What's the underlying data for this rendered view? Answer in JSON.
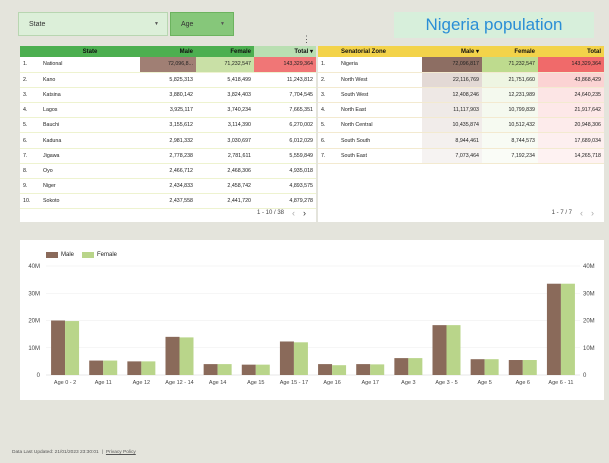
{
  "filters": {
    "state": "State",
    "age": "Age"
  },
  "title": "Nigeria population",
  "more_icon": "⋮",
  "colors": {
    "male": "#8a6a5a",
    "female": "#b9d58a",
    "state_header": "#4caf50",
    "zone_header": "#f3d34a",
    "title_text": "#2a8ed6"
  },
  "state_table": {
    "headers": {
      "state": "State",
      "male": "Male",
      "female": "Female",
      "total": "Total",
      "sort_icon": "▾"
    },
    "rows": [
      {
        "n": "1.",
        "name": "National",
        "male": "72,096,8...",
        "female": "71,232,547",
        "total": "143,329,364"
      },
      {
        "n": "2.",
        "name": "Kano",
        "male": "5,825,313",
        "female": "5,418,499",
        "total": "11,243,812"
      },
      {
        "n": "3.",
        "name": "Katsina",
        "male": "3,880,142",
        "female": "3,824,403",
        "total": "7,704,545"
      },
      {
        "n": "4.",
        "name": "Lagos",
        "male": "3,925,117",
        "female": "3,740,234",
        "total": "7,665,351"
      },
      {
        "n": "5.",
        "name": "Bauchi",
        "male": "3,155,612",
        "female": "3,114,390",
        "total": "6,270,002"
      },
      {
        "n": "6.",
        "name": "Kaduna",
        "male": "2,981,332",
        "female": "3,030,697",
        "total": "6,012,029"
      },
      {
        "n": "7.",
        "name": "Jigawa",
        "male": "2,778,238",
        "female": "2,781,611",
        "total": "5,559,849"
      },
      {
        "n": "8.",
        "name": "Oyo",
        "male": "2,466,712",
        "female": "2,468,306",
        "total": "4,935,018"
      },
      {
        "n": "9.",
        "name": "Niger",
        "male": "2,434,833",
        "female": "2,458,742",
        "total": "4,893,575"
      },
      {
        "n": "10.",
        "name": "Sokoto",
        "male": "2,437,558",
        "female": "2,441,720",
        "total": "4,879,278"
      }
    ],
    "pager": "1 - 10 / 38",
    "prev": "‹",
    "next": "›"
  },
  "zone_table": {
    "headers": {
      "zone": "Senatorial Zone",
      "male": "Male",
      "female": "Female",
      "total": "Total",
      "sort_icon": "▾"
    },
    "rows": [
      {
        "n": "1.",
        "name": "Nigeria",
        "male": "72,096,817",
        "female": "71,232,547",
        "total": "143,329,364"
      },
      {
        "n": "2.",
        "name": "North West",
        "male": "22,116,769",
        "female": "21,751,660",
        "total": "43,868,429"
      },
      {
        "n": "3.",
        "name": "South West",
        "male": "12,408,246",
        "female": "12,231,989",
        "total": "24,640,235"
      },
      {
        "n": "4.",
        "name": "North East",
        "male": "11,117,903",
        "female": "10,799,839",
        "total": "21,917,642"
      },
      {
        "n": "5.",
        "name": "North Central",
        "male": "10,435,874",
        "female": "10,512,432",
        "total": "20,948,306"
      },
      {
        "n": "6.",
        "name": "South South",
        "male": "8,944,461",
        "female": "8,744,573",
        "total": "17,689,034"
      },
      {
        "n": "7.",
        "name": "South East",
        "male": "7,073,464",
        "female": "7,192,234",
        "total": "14,265,718"
      }
    ],
    "pager": "1 - 7 / 7",
    "prev": "‹",
    "next": "›"
  },
  "chart_data": {
    "type": "bar",
    "categories": [
      "Age 0 - 2",
      "Age 11",
      "Age 12",
      "Age 12 - 14",
      "Age 14",
      "Age 15",
      "Age 15 - 17",
      "Age 16",
      "Age 17",
      "Age 3",
      "Age 3 - 5",
      "Age 5",
      "Age 6",
      "Age 6 - 11"
    ],
    "series": [
      {
        "name": "Male",
        "values": [
          20,
          5.3,
          5,
          14,
          4,
          3.8,
          12.3,
          4,
          4,
          6.2,
          18.3,
          5.8,
          5.5,
          33.5
        ]
      },
      {
        "name": "Female",
        "values": [
          19.8,
          5.3,
          5,
          13.8,
          4,
          3.8,
          12,
          3.6,
          3.9,
          6.2,
          18.3,
          5.8,
          5.5,
          33.5
        ]
      }
    ],
    "ylim": [
      0,
      40
    ],
    "y_ticks": [
      "0",
      "10M",
      "20M",
      "30M",
      "40M"
    ],
    "grid": true,
    "legend": "top-left"
  },
  "footer": {
    "updated": "Data Last Updated: 21/01/2023 23:30:01",
    "sep": "|",
    "privacy": "Privacy Policy"
  }
}
